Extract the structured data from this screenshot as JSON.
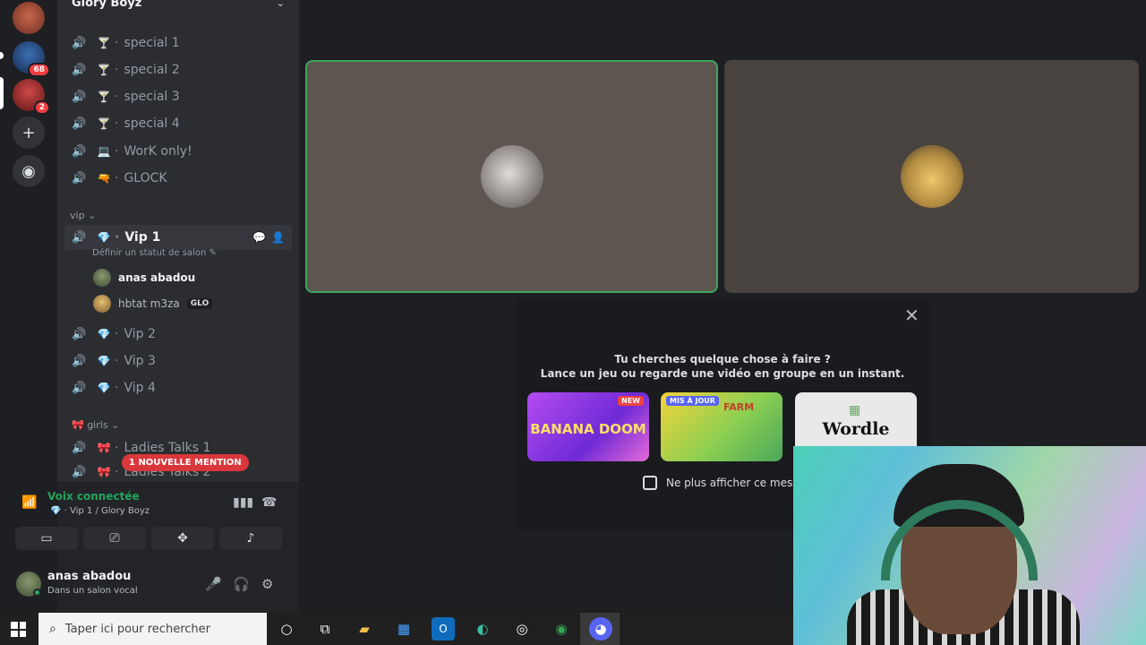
{
  "server": {
    "name": "Glory Boyz",
    "section_partial": "spécial"
  },
  "rail": {
    "servers": [
      {
        "name": "server-1",
        "badge": ""
      },
      {
        "name": "server-2",
        "badge": "68"
      },
      {
        "name": "server-3",
        "badge": "2"
      }
    ],
    "add_icon": "plus-icon",
    "explore_icon": "compass-icon"
  },
  "channels_special": [
    {
      "emoji": "🍸",
      "label": "special 1"
    },
    {
      "emoji": "🍸",
      "label": "special 2"
    },
    {
      "emoji": "🍸",
      "label": "special 3"
    },
    {
      "emoji": "🍸",
      "label": "special 4"
    },
    {
      "emoji": "💻",
      "label": "WorK only!"
    },
    {
      "emoji": "🔫",
      "label": "GLOCK"
    }
  ],
  "category_vip": {
    "label": "vip"
  },
  "vip_active": {
    "emoji": "💎",
    "label": "Vip 1",
    "status_prompt": "Définir un statut de salon"
  },
  "voice_users": [
    {
      "name": "anas abadou",
      "tag": ""
    },
    {
      "name": "hbtat m3za",
      "tag": "GLO"
    }
  ],
  "channels_vip": [
    {
      "emoji": "💎",
      "label": "Vip 2"
    },
    {
      "emoji": "💎",
      "label": "Vip 3"
    },
    {
      "emoji": "💎",
      "label": "Vip 4"
    }
  ],
  "category_girls": {
    "emoji": "🎀",
    "label": "girls"
  },
  "channels_girls": [
    {
      "emoji": "🎀",
      "label": "Ladies Talks 1"
    },
    {
      "emoji": "🎀",
      "label": "Ladies Talks 2"
    }
  ],
  "mention_badge": "1 NOUVELLE MENTION",
  "voice_panel": {
    "status": "Voix connectée",
    "channel": "Vip 1 / Glory Boyz"
  },
  "user_panel": {
    "name": "anas abadou",
    "status": "Dans un salon vocal"
  },
  "activity_popup": {
    "title": "Tu cherches quelque chose à faire ?",
    "subtitle": "Lance un jeu ou regarde une vidéo en groupe en un instant.",
    "cards": [
      {
        "title": "BANANA DOOM",
        "tag": "NEW"
      },
      {
        "title": "FARM",
        "tag": "MIS À JOUR"
      },
      {
        "title": "Wordle",
        "tag": ""
      }
    ],
    "checkbox_label": "Ne plus afficher ce messag"
  },
  "taskbar": {
    "search_placeholder": "Taper ici pour rechercher"
  },
  "colors": {
    "accent_green": "#23a55a",
    "speaking_border": "#3ba55c",
    "mention_red": "#da373c"
  }
}
